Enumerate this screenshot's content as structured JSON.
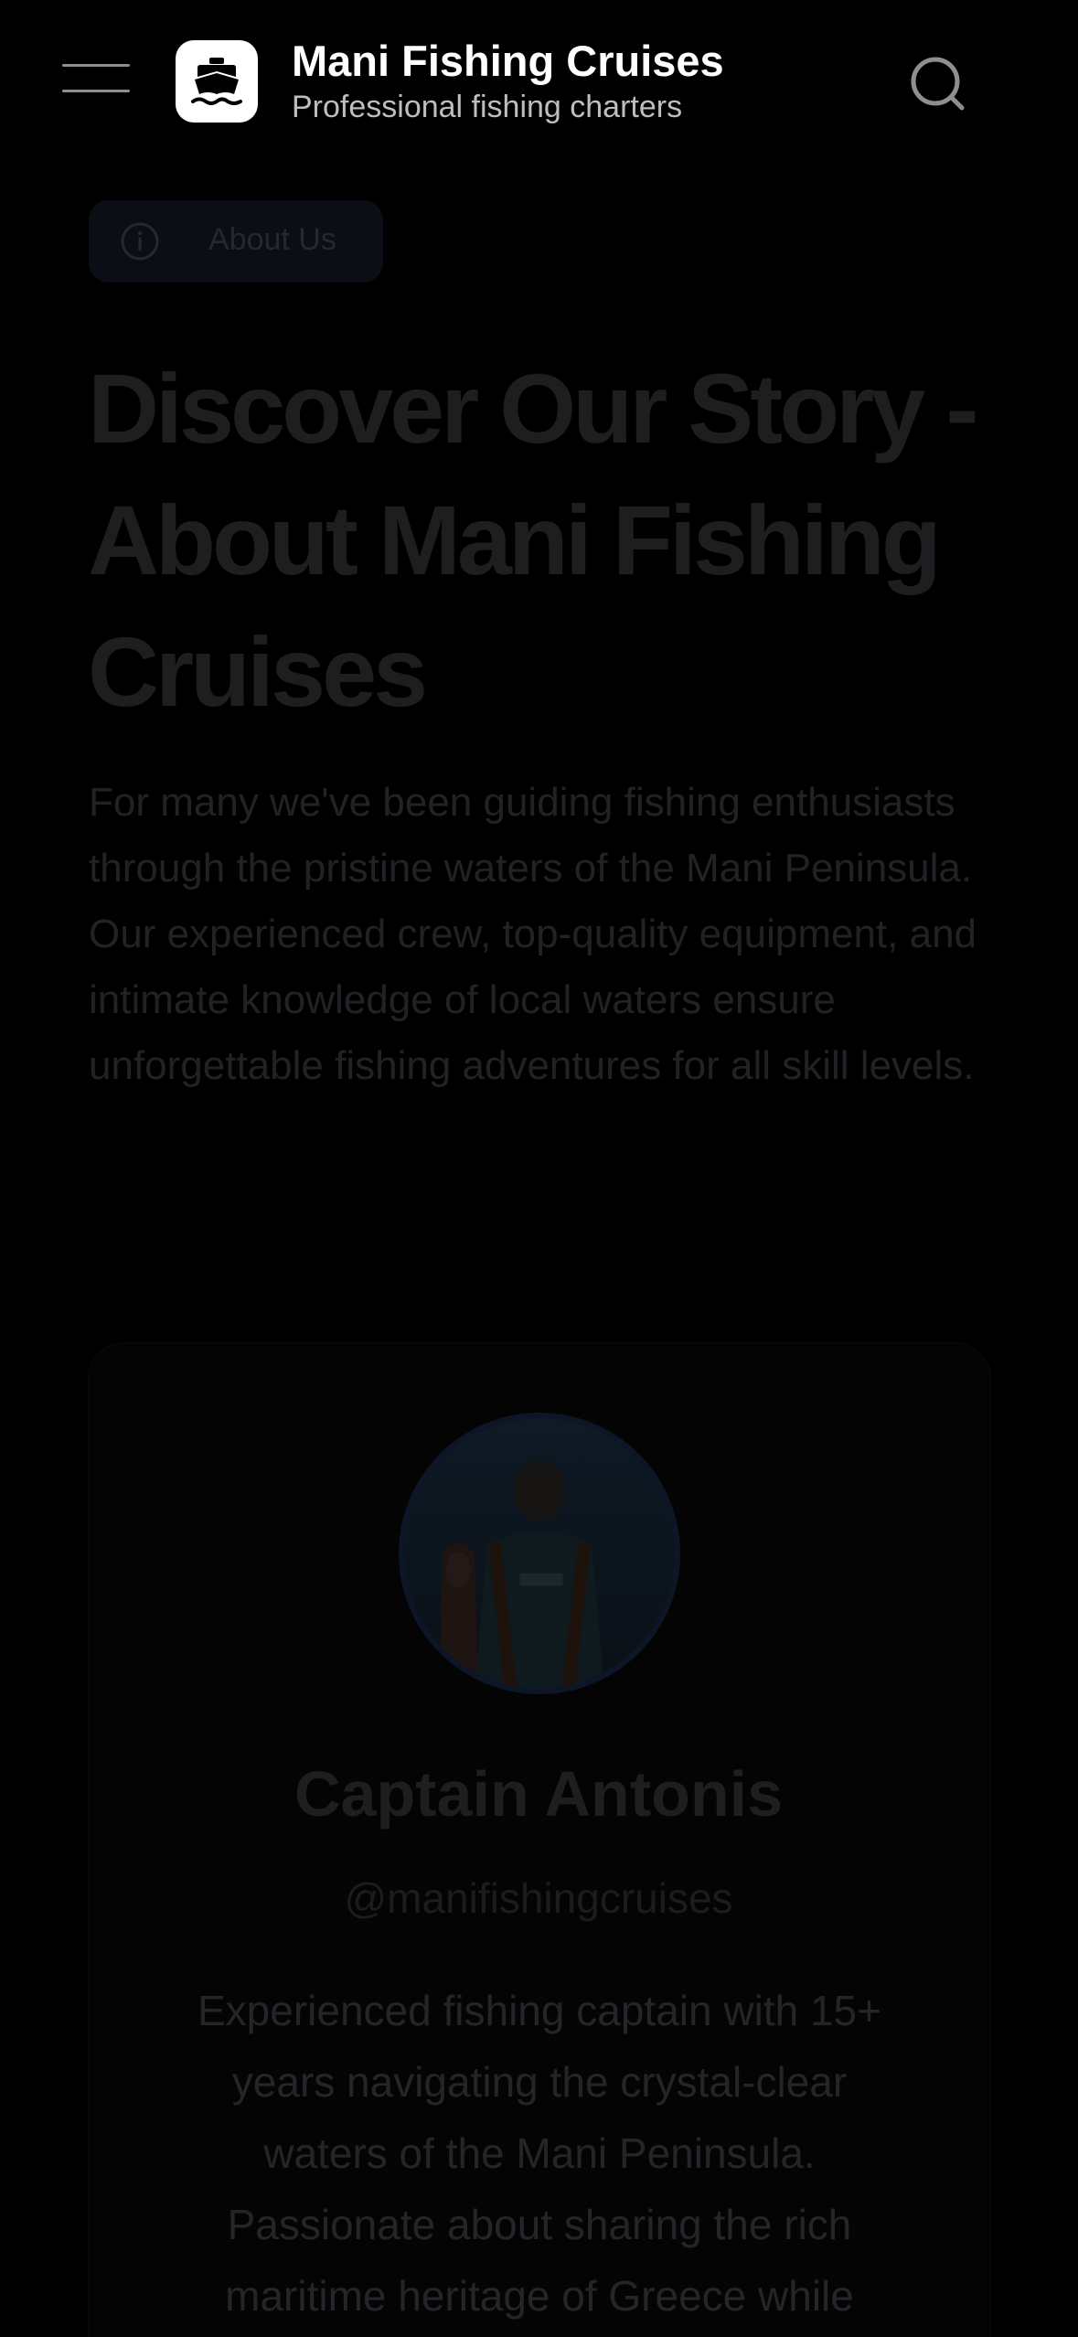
{
  "header": {
    "brand_title": "Mani Fishing Cruises",
    "brand_subtitle": "Professional fishing charters",
    "menu_icon": "hamburger-menu-icon",
    "logo_icon": "ship-icon",
    "search_icon": "search-icon"
  },
  "hero": {
    "badge_label": "About Us",
    "badge_icon": "info-icon",
    "title": "Discover Our Story - About Mani Fishing Cruises",
    "description": "For many we've been guiding fishing enthusiasts through the pristine waters of the Mani Peninsula. Our experienced crew, top-quality equipment, and intimate knowledge of local waters ensure unforgettable fishing adventures for all skill levels."
  },
  "profile": {
    "name": "Captain Antonis",
    "handle": "@manifishingcruises",
    "bio": "Experienced fishing captain with 15+ years navigating the crystal-clear waters of the Mani Peninsula. Passionate about sharing the rich maritime heritage of Greece while"
  },
  "colors": {
    "background": "#000000",
    "brand_text": "#ffffff",
    "muted_text": "#1e1e20",
    "avatar_ring": "#0c1626"
  }
}
